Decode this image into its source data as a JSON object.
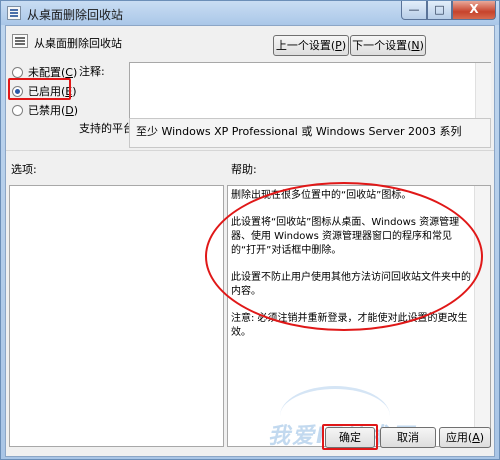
{
  "window": {
    "title": "从桌面删除回收站",
    "minimize_glyph": "—",
    "maximize_glyph": "□",
    "close_glyph": "X"
  },
  "policy": {
    "name": "从桌面删除回收站",
    "icon": "policy-document-icon"
  },
  "nav": {
    "prev_label": "上一个设置(",
    "prev_key": "P",
    "prev_suffix": ")",
    "next_label": "下一个设置(",
    "next_key": "N",
    "next_suffix": ")"
  },
  "radios": [
    {
      "label": "未配置(",
      "key": "C",
      "suffix": ")",
      "checked": false
    },
    {
      "label": "已启用(",
      "key": "E",
      "suffix": ")",
      "checked": true
    },
    {
      "label": "已禁用(",
      "key": "D",
      "suffix": ")",
      "checked": false
    }
  ],
  "labels": {
    "comment": "注释:",
    "platform": "支持的平台:",
    "options": "选项:",
    "help": "帮助:"
  },
  "comment_value": "",
  "platform_value": "至少 Windows XP Professional 或 Windows Server 2003 系列",
  "help_paragraphs": [
    "删除出现在很多位置中的“回收站”图标。",
    "此设置将“回收站”图标从桌面、Windows 资源管理器、使用 Windows 资源管理器窗口的程序和常见的“打开”对话框中删除。",
    "此设置不防止用户使用其他方法访问回收站文件夹中的内容。",
    "注意: 必须注销并重新登录，才能使对此设置的更改生效。"
  ],
  "buttons": {
    "ok": "确定",
    "cancel": "取消",
    "apply_label": "应用(",
    "apply_key": "A",
    "apply_suffix": ")"
  },
  "watermark": "我爱IT技术网",
  "colors": {
    "annotation_red": "#e01818",
    "titlebar": "#bfd6ee"
  }
}
